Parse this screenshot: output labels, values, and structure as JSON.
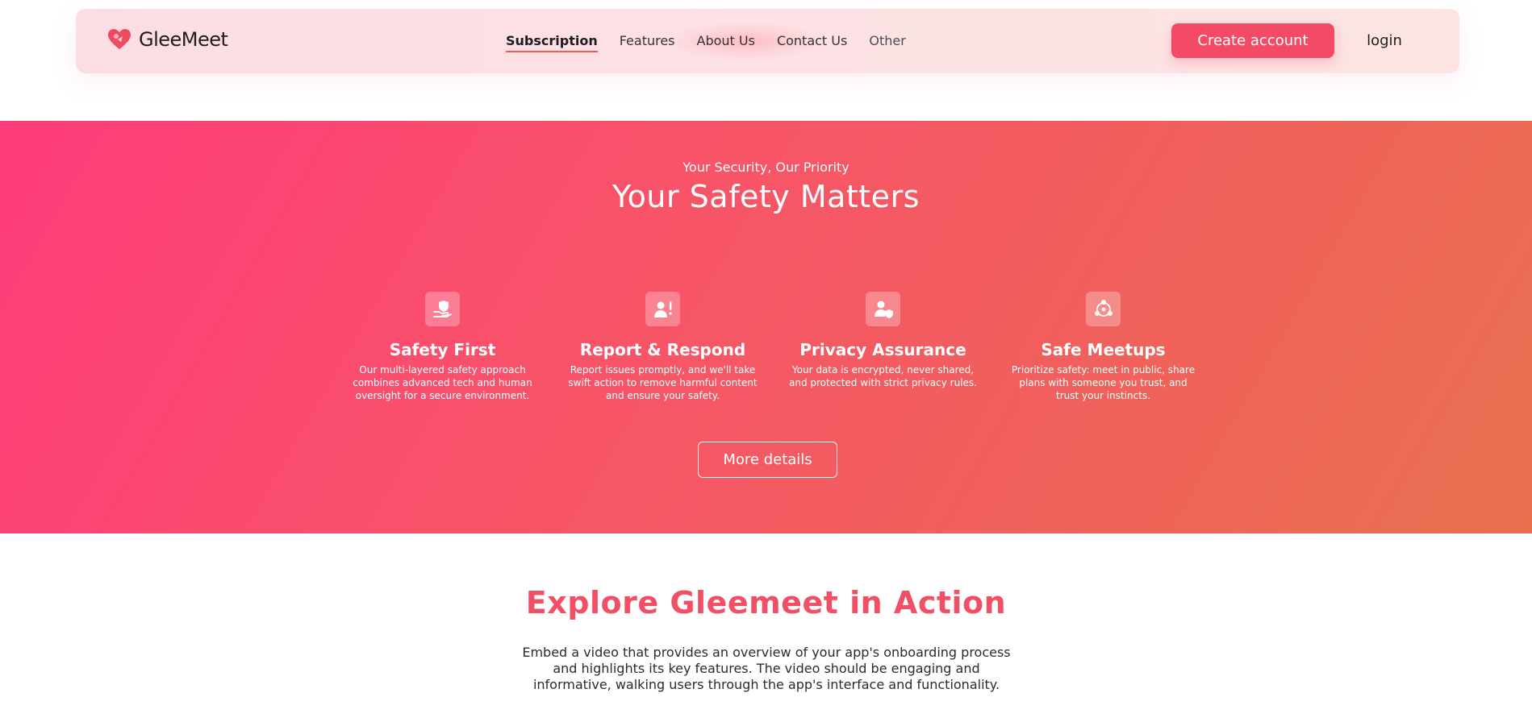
{
  "navbar": {
    "brand_name": "GleeMeet",
    "links": [
      {
        "label": "Subscription",
        "active": true
      },
      {
        "label": "Features",
        "active": false
      },
      {
        "label": "About Us",
        "active": false
      },
      {
        "label": "Contact Us",
        "active": false
      },
      {
        "label": "Other",
        "active": false
      }
    ],
    "create_account_label": "Create account",
    "login_label": "login"
  },
  "safety": {
    "kicker": "Your Security, Our Priority",
    "title": "Your Safety Matters",
    "features": [
      {
        "icon": "shield-hand-icon",
        "title": "Safety First",
        "text": "Our multi-layered safety approach combines advanced tech and human oversight for a secure environment."
      },
      {
        "icon": "report-user-icon",
        "title": "Report & Respond",
        "text": "Report issues promptly, and we'll take swift action to remove harmful content and ensure your safety."
      },
      {
        "icon": "user-shield-icon",
        "title": "Privacy Assurance",
        "text": "Your data is encrypted, never shared, and protected with strict privacy rules."
      },
      {
        "icon": "people-network-icon",
        "title": "Safe Meetups",
        "text": "Prioritize safety: meet in public, share plans with someone you trust, and trust your instincts."
      }
    ],
    "more_details_label": "More details"
  },
  "explore": {
    "title": "Explore Gleemeet in Action",
    "description": "Embed a video that provides an overview of your app's onboarding process and highlights its key features. The video should be engaging and informative, walking users through the app's interface and functionality."
  },
  "colors": {
    "accent": "#f34b66",
    "gradient_start": "#ff3b7b",
    "gradient_end": "#e8704f",
    "explore_title": "#f04f66"
  }
}
